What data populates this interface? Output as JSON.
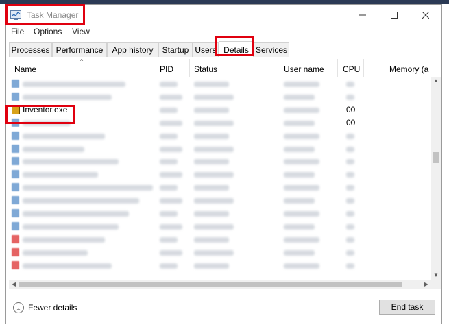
{
  "window": {
    "title": "Task Manager"
  },
  "menu": [
    "File",
    "Options",
    "View"
  ],
  "tabs": [
    "Processes",
    "Performance",
    "App history",
    "Startup",
    "Users",
    "Details",
    "Services"
  ],
  "active_tab": "Details",
  "columns": [
    "Name",
    "PID",
    "Status",
    "User name",
    "CPU",
    "Memory (a"
  ],
  "rows": [
    {
      "name": "",
      "cpu": "",
      "obscured": true
    },
    {
      "name": "",
      "pid": "",
      "status": "",
      "user": "",
      "cpu": "",
      "obscured": true
    },
    {
      "name": "Inventor.exe",
      "cpu": "00",
      "obscured": false,
      "highlighted": true
    },
    {
      "name": "",
      "cpu": "00",
      "obscured": true
    },
    {
      "name": "",
      "obscured": true
    },
    {
      "name": "",
      "obscured": true
    },
    {
      "name": "",
      "obscured": true
    },
    {
      "name": "",
      "obscured": true
    },
    {
      "name": "",
      "obscured": true
    },
    {
      "name": "",
      "obscured": true
    },
    {
      "name": "",
      "obscured": true
    },
    {
      "name": "",
      "obscured": true
    },
    {
      "name": "",
      "obscured": true
    },
    {
      "name": "",
      "obscured": true
    },
    {
      "name": "",
      "obscured": true
    }
  ],
  "footer": {
    "fewer_details": "Fewer details",
    "end_task": "End task"
  },
  "icons": {
    "app": "task-manager-icon",
    "minimize": "minimize-icon",
    "maximize": "maximize-icon",
    "close": "close-icon",
    "collapse": "chevron-up-icon"
  },
  "colors": {
    "highlight": "#e0000f",
    "title_text": "#888888"
  }
}
